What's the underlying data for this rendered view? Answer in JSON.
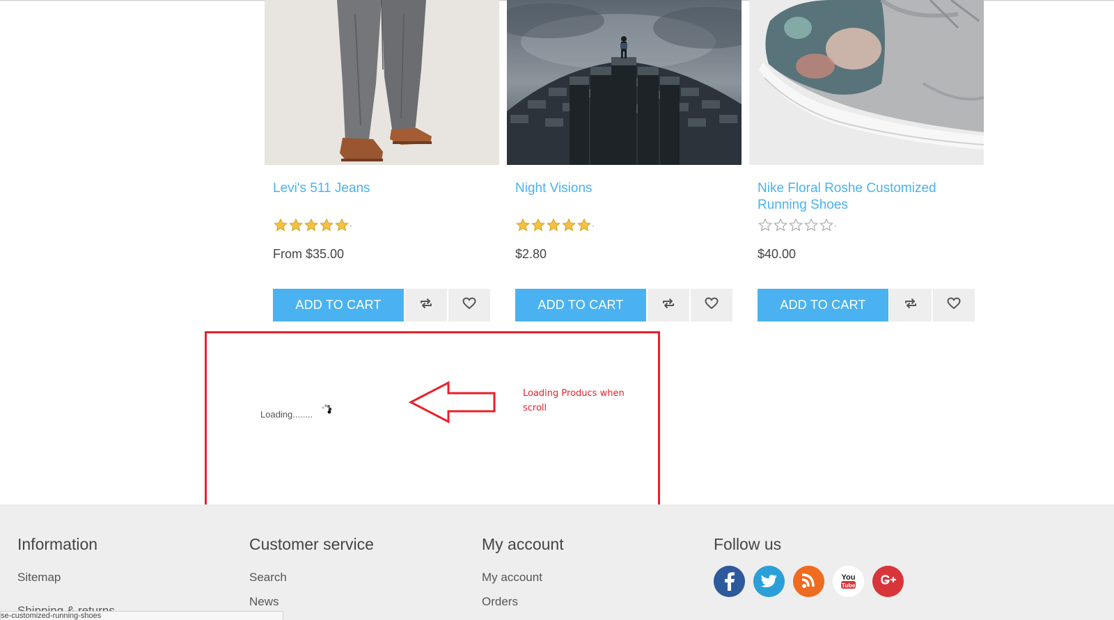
{
  "products": [
    {
      "title": "Levi's 511 Jeans",
      "rating": 5,
      "rating_max": 5,
      "price": "From $35.00",
      "add_to_cart": "ADD TO CART"
    },
    {
      "title": "Night Visions",
      "rating": 5,
      "rating_max": 5,
      "price": "$2.80",
      "add_to_cart": "ADD TO CART"
    },
    {
      "title": "Nike Floral Roshe Customized Running Shoes",
      "rating": 0,
      "rating_max": 5,
      "price": "$40.00",
      "add_to_cart": "ADD TO CART"
    }
  ],
  "loading": {
    "text": "Loading........",
    "annotation": "Loading Producs when scroll"
  },
  "footer": {
    "information": {
      "title": "Information",
      "links": [
        "Sitemap",
        "Shipping & returns"
      ]
    },
    "customer_service": {
      "title": "Customer service",
      "links": [
        "Search",
        "News"
      ]
    },
    "my_account": {
      "title": "My account",
      "links": [
        "My account",
        "Orders"
      ]
    },
    "follow_us": {
      "title": "Follow us",
      "icons": [
        "facebook-icon",
        "twitter-icon",
        "rss-icon",
        "youtube-icon",
        "google-plus-icon"
      ],
      "youtube_label_top": "You",
      "youtube_label_bottom": "Tube"
    }
  },
  "status_bar": {
    "url": "se-customized-running-shoes"
  },
  "colors": {
    "accent": "#4ab2f1",
    "annotation_red": "#e8202a",
    "footer_bg": "#eeeeee",
    "star_gold": "#f4c243",
    "facebook": "#2d5a9c",
    "twitter": "#2a9fd8",
    "rss": "#ef6b1f",
    "youtube": "#ffffff",
    "google_plus": "#d8353a"
  }
}
